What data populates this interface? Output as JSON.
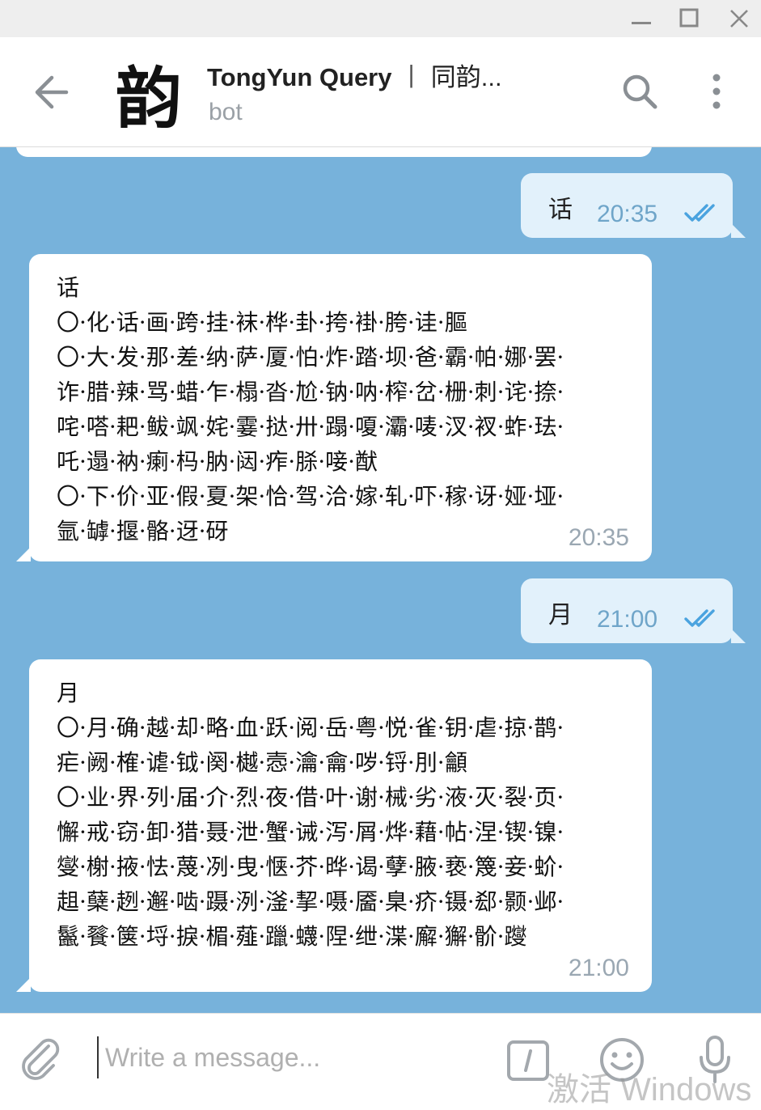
{
  "window": {
    "minimize_icon": "minimize-icon",
    "maximize_icon": "maximize-icon",
    "close_icon": "close-icon"
  },
  "header": {
    "avatar_char": "韵",
    "title_latin": "TongYun Query",
    "title_separator": "丨",
    "title_cjk": "同韵...",
    "subtitle": "bot",
    "icons": [
      "back-arrow-icon",
      "search-icon",
      "more-vertical-icon"
    ]
  },
  "messages": [
    {
      "direction": "out",
      "text": "话",
      "time": "20:35",
      "status": "read"
    },
    {
      "direction": "in",
      "lines": [
        "话",
        "〇·化·话·画·跨·挂·袜·桦·卦·挎·褂·胯·诖·膒",
        "〇·大·发·那·差·纳·萨·厦·怕·炸·踏·坝·爸·霸·帕·娜·罢·",
        "诈·腊·辣·骂·蜡·乍·榻·沓·尬·钠·呐·榨·岔·栅·刺·诧·捺·",
        "咤·嗒·耙·鲅·飒·姹·霎·挞·卅·蹋·嗄·灞·唛·汊·衩·蚱·珐·",
        "吒·遢·衲·瘌·杩·肭·闼·痄·脎·唼·猷",
        "〇·下·价·亚·假·夏·架·恰·驾·洽·嫁·轧·吓·稼·讶·娅·垭·",
        "氩·罅·揠·骼·迓·砑"
      ],
      "time": "20:35"
    },
    {
      "direction": "out",
      "text": "月",
      "time": "21:00",
      "status": "read"
    },
    {
      "direction": "in",
      "lines": [
        "月",
        "〇·月·确·越·却·略·血·跃·阅·岳·粤·悦·雀·钥·虐·掠·鹊·",
        "疟·阙·榷·谑·钺·阕·樾·悫·瀹·龠·哕·锊·刖·龥",
        "〇·业·界·列·届·介·烈·夜·借·叶·谢·械·劣·液·灭·裂·页·",
        "懈·戒·窃·卸·猎·聂·泄·蟹·诫·泻·屑·烨·藉·帖·涅·锲·镍·",
        "燮·榭·掖·怯·蔑·冽·曳·惬·芥·晔·谒·孽·腋·亵·篾·妾·蚧·",
        "趄·蘖·趔·邂·啮·蹑·洌·滏·挈·嗫·靥·臬·疥·镊·郄·颢·邺·",
        "鬣·餮·箧·埒·捩·楣·薤·躐·蠛·陧·绁·渫·廨·獬·骱·躞"
      ],
      "time": "21:00"
    }
  ],
  "composer": {
    "placeholder": "Write a message...",
    "icons": [
      "paperclip-icon",
      "bot-command-icon",
      "emoji-icon",
      "microphone-icon"
    ]
  },
  "watermark": "激活 Windows"
}
